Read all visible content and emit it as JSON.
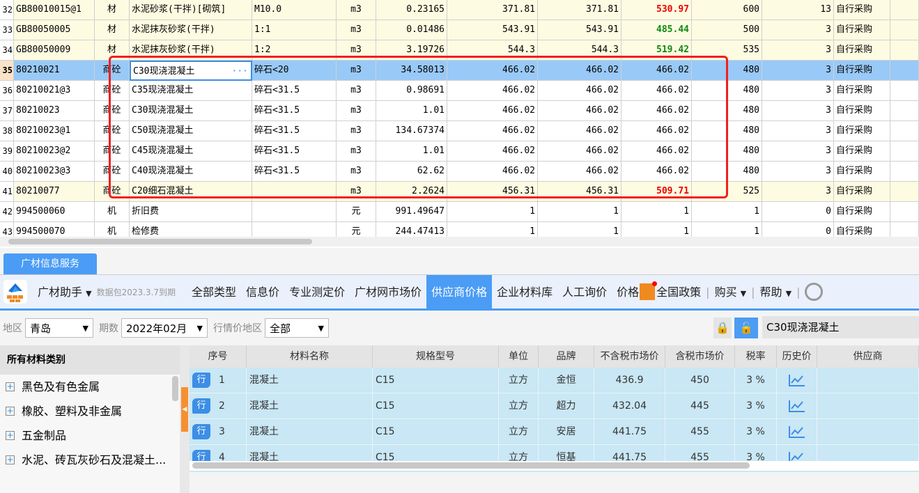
{
  "top_table": {
    "rows": [
      {
        "n": "32",
        "code": "GB80010015@1",
        "type": "材",
        "name": "水泥砂浆(干拌)[砌筑]",
        "spec": "M10.0",
        "unit": "m3",
        "qty": "0.23165",
        "p1": "371.81",
        "p2": "371.81",
        "p3": "530.97",
        "p3_color": "red",
        "c10": "600",
        "c11": "13",
        "src": "自行采购",
        "style": "y"
      },
      {
        "n": "33",
        "code": "GB80050005",
        "type": "材",
        "name": "水泥抹灰砂浆(干拌)",
        "spec": "1:1",
        "unit": "m3",
        "qty": "0.01486",
        "p1": "543.91",
        "p2": "543.91",
        "p3": "485.44",
        "p3_color": "grn",
        "c10": "500",
        "c11": "3",
        "src": "自行采购",
        "style": "y"
      },
      {
        "n": "34",
        "code": "GB80050009",
        "type": "材",
        "name": "水泥抹灰砂浆(干拌)",
        "spec": "1:2",
        "unit": "m3",
        "qty": "3.19726",
        "p1": "544.3",
        "p2": "544.3",
        "p3": "519.42",
        "p3_color": "grn",
        "c10": "535",
        "c11": "3",
        "src": "自行采购",
        "style": "y"
      },
      {
        "n": "35",
        "code": "80210021",
        "type": "商砼",
        "name": "C30现浇混凝土",
        "spec": "碎石<20",
        "unit": "m3",
        "qty": "34.58013",
        "p1": "466.02",
        "p2": "466.02",
        "p3": "466.02",
        "p3_color": "",
        "c10": "480",
        "c11": "3",
        "src": "自行采购",
        "style": "sel"
      },
      {
        "n": "36",
        "code": "80210021@3",
        "type": "商砼",
        "name": "C35现浇混凝土",
        "spec": "碎石<31.5",
        "unit": "m3",
        "qty": "0.98691",
        "p1": "466.02",
        "p2": "466.02",
        "p3": "466.02",
        "p3_color": "",
        "c10": "480",
        "c11": "3",
        "src": "自行采购",
        "style": ""
      },
      {
        "n": "37",
        "code": "80210023",
        "type": "商砼",
        "name": "C30现浇混凝土",
        "spec": "碎石<31.5",
        "unit": "m3",
        "qty": "1.01",
        "p1": "466.02",
        "p2": "466.02",
        "p3": "466.02",
        "p3_color": "",
        "c10": "480",
        "c11": "3",
        "src": "自行采购",
        "style": ""
      },
      {
        "n": "38",
        "code": "80210023@1",
        "type": "商砼",
        "name": "C50现浇混凝土",
        "spec": "碎石<31.5",
        "unit": "m3",
        "qty": "134.67374",
        "p1": "466.02",
        "p2": "466.02",
        "p3": "466.02",
        "p3_color": "",
        "c10": "480",
        "c11": "3",
        "src": "自行采购",
        "style": ""
      },
      {
        "n": "39",
        "code": "80210023@2",
        "type": "商砼",
        "name": "C45现浇混凝土",
        "spec": "碎石<31.5",
        "unit": "m3",
        "qty": "1.01",
        "p1": "466.02",
        "p2": "466.02",
        "p3": "466.02",
        "p3_color": "",
        "c10": "480",
        "c11": "3",
        "src": "自行采购",
        "style": ""
      },
      {
        "n": "40",
        "code": "80210023@3",
        "type": "商砼",
        "name": "C40现浇混凝土",
        "spec": "碎石<31.5",
        "unit": "m3",
        "qty": "62.62",
        "p1": "466.02",
        "p2": "466.02",
        "p3": "466.02",
        "p3_color": "",
        "c10": "480",
        "c11": "3",
        "src": "自行采购",
        "style": ""
      },
      {
        "n": "41",
        "code": "80210077",
        "type": "商砼",
        "name": "C20细石混凝土",
        "spec": "",
        "unit": "m3",
        "qty": "2.2624",
        "p1": "456.31",
        "p2": "456.31",
        "p3": "509.71",
        "p3_color": "red",
        "c10": "525",
        "c11": "3",
        "src": "自行采购",
        "style": "y"
      },
      {
        "n": "42",
        "code": "994500060",
        "type": "机",
        "name": "折旧费",
        "spec": "",
        "unit": "元",
        "qty": "991.49647",
        "p1": "1",
        "p2": "1",
        "p3": "1",
        "p3_color": "",
        "c10": "1",
        "c11": "0",
        "src": "自行采购",
        "style": ""
      },
      {
        "n": "43",
        "code": "994500070",
        "type": "机",
        "name": "检修费",
        "spec": "",
        "unit": "元",
        "qty": "244.47413",
        "p1": "1",
        "p2": "1",
        "p3": "1",
        "p3_color": "",
        "c10": "1",
        "c11": "0",
        "src": "自行采购",
        "style": ""
      }
    ]
  },
  "panel_tab": "广材信息服务",
  "toolbar": {
    "assistant": "广材助手",
    "package_note": "数据包2023.3.7到期",
    "tabs": [
      "全部类型",
      "信息价",
      "专业测定价",
      "广材网市场价",
      "供应商价格",
      "企业材料库",
      "人工询价",
      "价格"
    ],
    "active_tab": 4,
    "policy": "全国政策",
    "buy": "购买",
    "help": "帮助"
  },
  "filters": {
    "region_label": "地区",
    "region": "青岛",
    "period_label": "期数",
    "period": "2022年02月",
    "market_label": "行情价地区",
    "market": "全部",
    "search_value": "C30现浇混凝土"
  },
  "categories": {
    "header": "所有材料类别",
    "items": [
      "黑色及有色金属",
      "橡胶、塑料及非金属",
      "五金制品",
      "水泥、砖瓦灰砂石及混凝土..."
    ]
  },
  "grid": {
    "headers": [
      "序号",
      "材料名称",
      "规格型号",
      "单位",
      "品牌",
      "不含税市场价",
      "含税市场价",
      "税率",
      "历史价",
      "供应商"
    ],
    "badge": "行",
    "rows": [
      {
        "n": "1",
        "name": "混凝土",
        "spec": "C15",
        "unit": "立方",
        "brand": "金恒",
        "pre": "436.9",
        "post": "450",
        "tax": "3 %"
      },
      {
        "n": "2",
        "name": "混凝土",
        "spec": "C15",
        "unit": "立方",
        "brand": "超力",
        "pre": "432.04",
        "post": "445",
        "tax": "3 %"
      },
      {
        "n": "3",
        "name": "混凝土",
        "spec": "C15",
        "unit": "立方",
        "brand": "安居",
        "pre": "441.75",
        "post": "455",
        "tax": "3 %"
      },
      {
        "n": "4",
        "name": "混凝土",
        "spec": "C15",
        "unit": "立方",
        "brand": "恒基",
        "pre": "441.75",
        "post": "455",
        "tax": "3 %"
      }
    ]
  }
}
